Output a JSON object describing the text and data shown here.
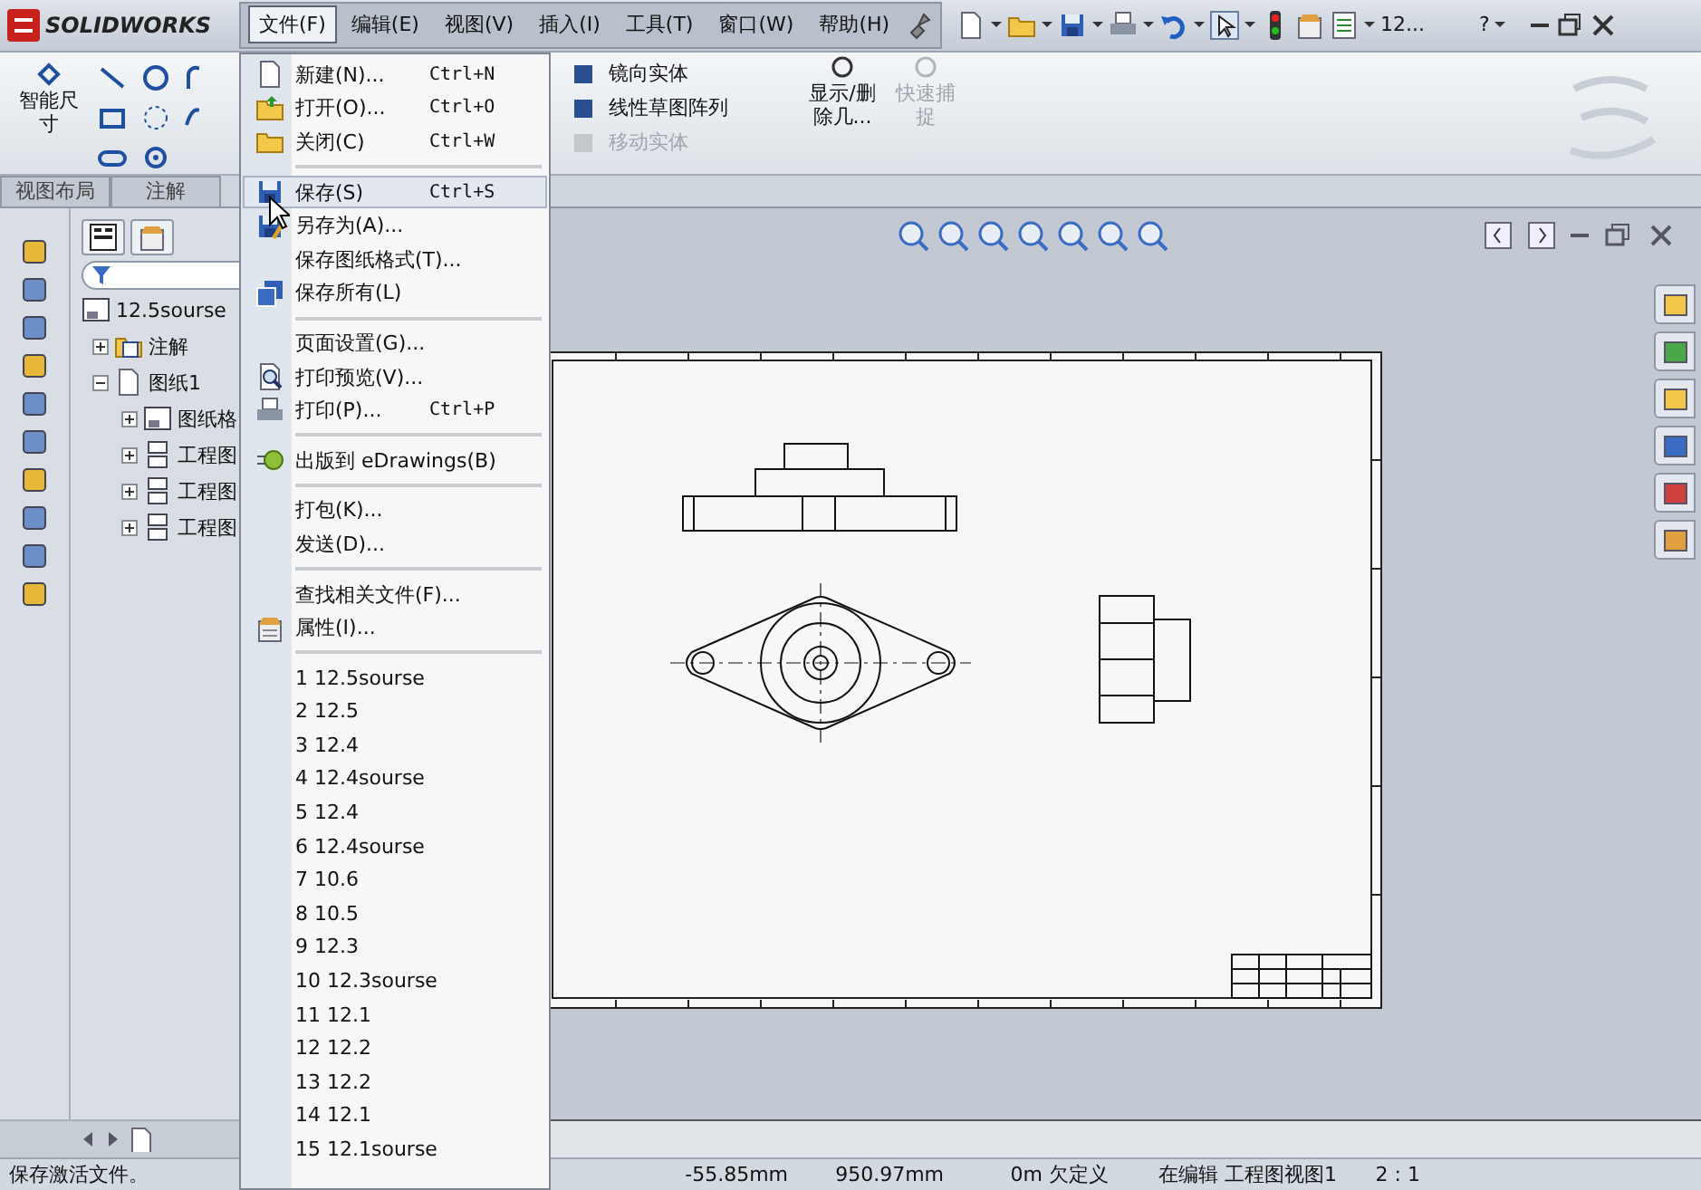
{
  "app": {
    "logo": "SOLIDWORKS"
  },
  "menubar": [
    {
      "label": "文件(F)",
      "selected": true
    },
    {
      "label": "编辑(E)",
      "selected": false
    },
    {
      "label": "视图(V)",
      "selected": false
    },
    {
      "label": "插入(I)",
      "selected": false
    },
    {
      "label": "工具(T)",
      "selected": false
    },
    {
      "label": "窗口(W)",
      "selected": false
    },
    {
      "label": "帮助(H)",
      "selected": false
    }
  ],
  "toolbar": {
    "document": "12...",
    "help": "?"
  },
  "ribbon": {
    "smart_dimension": "智能尺寸",
    "tools": [
      {
        "label": "镜向实体",
        "disabled": false
      },
      {
        "label": "线性草图阵列",
        "disabled": false
      },
      {
        "label": "移动实体",
        "disabled": true
      }
    ],
    "big_buttons": [
      {
        "label": "显示/删除几...",
        "disabled": false
      },
      {
        "label": "快速捕捉",
        "disabled": true
      }
    ]
  },
  "tabs": [
    {
      "label": "视图布局",
      "selected": false
    },
    {
      "label": "注解",
      "selected": false
    }
  ],
  "tree": {
    "root": "12.5sourse",
    "children": [
      {
        "label": "注解",
        "kind": "annotation",
        "expanded": false
      },
      {
        "label": "图纸1",
        "kind": "sheet",
        "expanded": true,
        "children": [
          {
            "label": "图纸格",
            "kind": "format",
            "expanded": false
          },
          {
            "label": "工程图",
            "kind": "view",
            "expanded": false
          },
          {
            "label": "工程图",
            "kind": "view",
            "expanded": false
          },
          {
            "label": "工程图",
            "kind": "view",
            "expanded": false
          }
        ]
      }
    ]
  },
  "file_menu": [
    {
      "kind": "item",
      "label": "新建(N)...",
      "shortcut": "Ctrl+N",
      "highlighted": false
    },
    {
      "kind": "item",
      "label": "打开(O)...",
      "shortcut": "Ctrl+O",
      "highlighted": false
    },
    {
      "kind": "item",
      "label": "关闭(C)",
      "shortcut": "Ctrl+W",
      "highlighted": false
    },
    {
      "kind": "separator"
    },
    {
      "kind": "item",
      "label": "保存(S)",
      "shortcut": "Ctrl+S",
      "highlighted": true
    },
    {
      "kind": "item",
      "label": "另存为(A)...",
      "highlighted": false
    },
    {
      "kind": "item",
      "label": "保存图纸格式(T)...",
      "highlighted": false
    },
    {
      "kind": "item",
      "label": "保存所有(L)",
      "highlighted": false
    },
    {
      "kind": "separator"
    },
    {
      "kind": "item",
      "label": "页面设置(G)...",
      "highlighted": false
    },
    {
      "kind": "item",
      "label": "打印预览(V)...",
      "highlighted": false
    },
    {
      "kind": "item",
      "label": "打印(P)...",
      "shortcut": "Ctrl+P",
      "highlighted": false
    },
    {
      "kind": "separator"
    },
    {
      "kind": "item",
      "label": "出版到 eDrawings(B)",
      "highlighted": false
    },
    {
      "kind": "separator"
    },
    {
      "kind": "item",
      "label": "打包(K)...",
      "highlighted": false
    },
    {
      "kind": "item",
      "label": "发送(D)...",
      "highlighted": false
    },
    {
      "kind": "separator"
    },
    {
      "kind": "item",
      "label": "查找相关文件(F)...",
      "highlighted": false
    },
    {
      "kind": "item",
      "label": "属性(I)...",
      "highlighted": false
    },
    {
      "kind": "separator"
    },
    {
      "kind": "item",
      "label": "1 12.5sourse",
      "highlighted": false
    },
    {
      "kind": "item",
      "label": "2 12.5",
      "highlighted": false
    },
    {
      "kind": "item",
      "label": "3 12.4",
      "highlighted": false
    },
    {
      "kind": "item",
      "label": "4 12.4sourse",
      "highlighted": false
    },
    {
      "kind": "item",
      "label": "5 12.4",
      "highlighted": false
    },
    {
      "kind": "item",
      "label": "6 12.4sourse",
      "highlighted": false
    },
    {
      "kind": "item",
      "label": "7 10.6",
      "highlighted": false
    },
    {
      "kind": "item",
      "label": "8 10.5",
      "highlighted": false
    },
    {
      "kind": "item",
      "label": "9 12.3",
      "highlighted": false
    },
    {
      "kind": "item",
      "label": "10 12.3sourse",
      "highlighted": false
    },
    {
      "kind": "item",
      "label": "11 12.1",
      "highlighted": false
    },
    {
      "kind": "item",
      "label": "12 12.2",
      "highlighted": false
    },
    {
      "kind": "item",
      "label": "13 12.2",
      "highlighted": false
    },
    {
      "kind": "item",
      "label": "14 12.1",
      "highlighted": false
    },
    {
      "kind": "item",
      "label": "15 12.1sourse",
      "highlighted": false
    }
  ],
  "status_bar": {
    "message": "保存激活文件。",
    "fields": [
      "-55.85mm",
      "950.97mm",
      "0m 欠定义",
      "在编辑 工程图视图1",
      "2 : 1"
    ]
  }
}
